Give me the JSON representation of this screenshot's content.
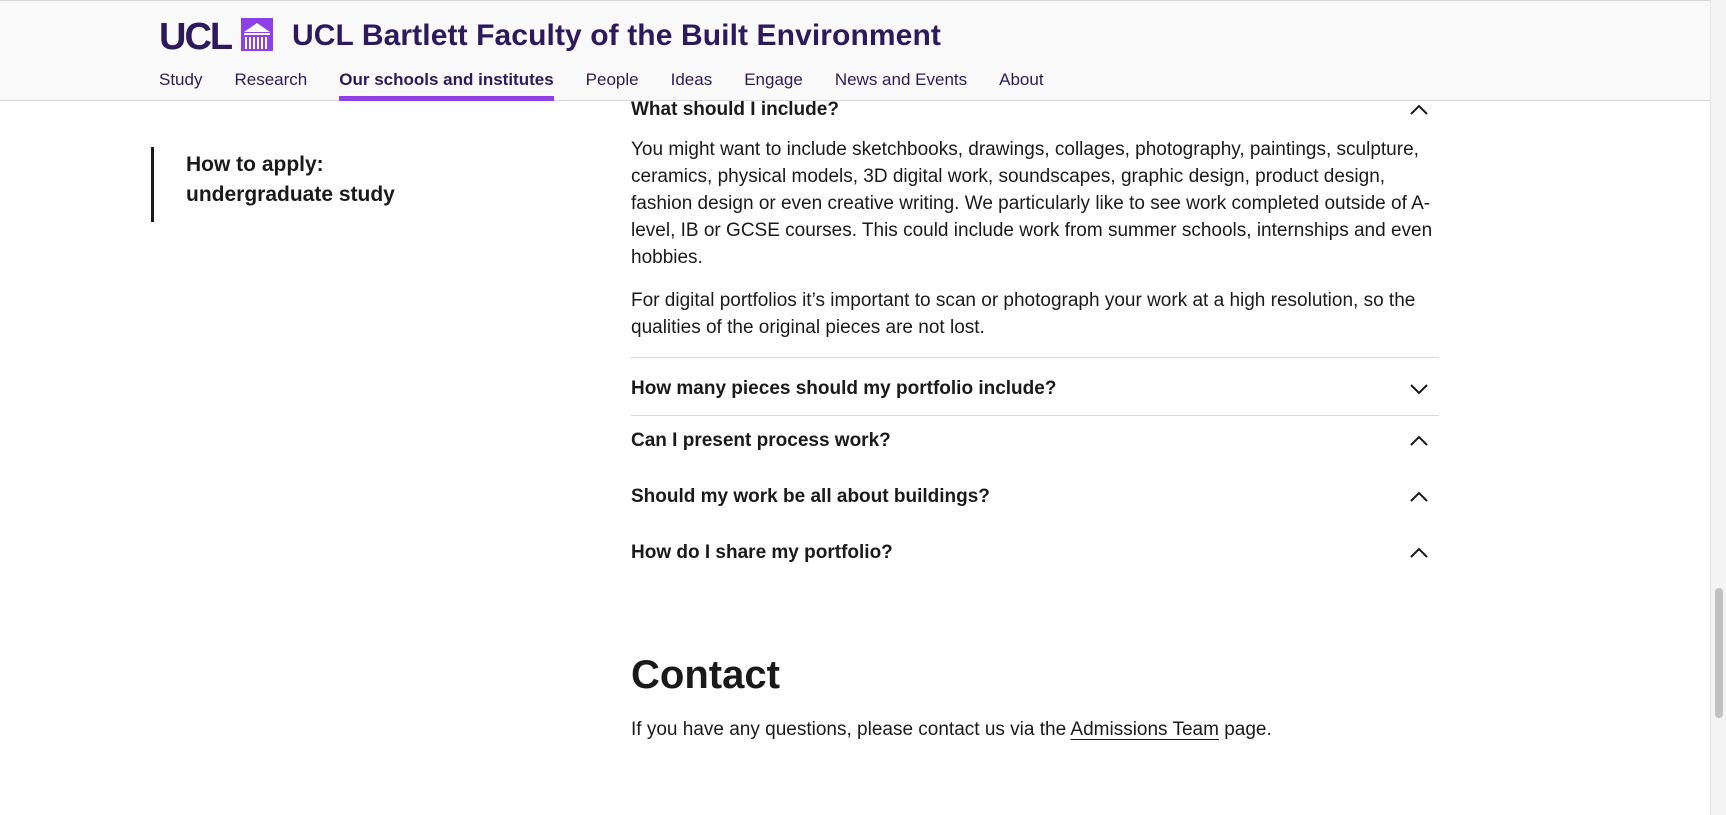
{
  "header": {
    "logo_text": "UCL",
    "site_title": "UCL Bartlett Faculty of the Built Environment",
    "nav": [
      {
        "label": "Study"
      },
      {
        "label": "Research"
      },
      {
        "label": "Our schools and institutes",
        "active": true
      },
      {
        "label": "People"
      },
      {
        "label": "Ideas"
      },
      {
        "label": "Engage"
      },
      {
        "label": "News and Events"
      },
      {
        "label": "About"
      }
    ]
  },
  "sidebar": {
    "link_line1": "How to apply:",
    "link_line2": "undergraduate study"
  },
  "accordion": {
    "expanded": {
      "title": "What should I include?",
      "icon": "chevron-up-icon",
      "paragraph1": "You might want to include sketchbooks, drawings, collages, photography, paintings, sculpture, ceramics, physical models, 3D digital work, soundscapes, graphic design, product design, fashion design or even creative writing. We particularly like to see work completed outside of A-level, IB or GCSE courses. This could include work from summer schools, internships and even hobbies.",
      "paragraph2": "For digital portfolios it’s important to scan or photograph your work at a high resolution, so the qualities of the original pieces are not lost."
    },
    "items": [
      {
        "title": "How many pieces should my portfolio include?",
        "icon": "chevron-down-icon"
      },
      {
        "title": "Can I present process work?",
        "icon": "chevron-up-icon"
      },
      {
        "title": "Should my work be all about buildings?",
        "icon": "chevron-up-icon"
      },
      {
        "title": "How do I share my portfolio?",
        "icon": "chevron-up-icon"
      }
    ]
  },
  "contact": {
    "heading": "Contact",
    "text_before": "If you have any questions, please contact us via the ",
    "link_text": "Admissions Team",
    "text_after": " page."
  },
  "colors": {
    "brand_purple": "#2c1a5c",
    "accent_purple": "#8f3fe6"
  }
}
